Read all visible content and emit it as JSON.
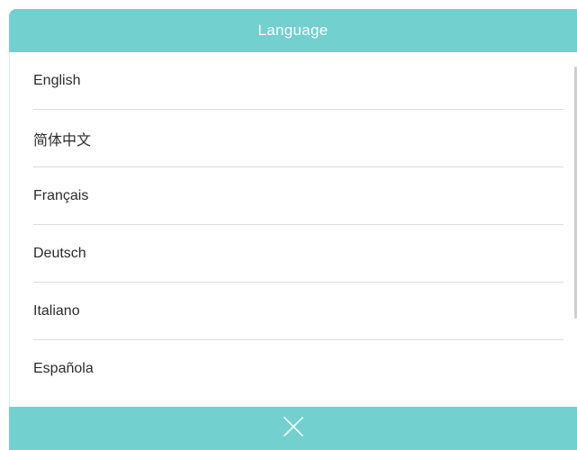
{
  "dialog": {
    "title": "Language",
    "close_icon": "close-icon"
  },
  "languages": [
    {
      "label": "English"
    },
    {
      "label": "简体中文"
    },
    {
      "label": "Français"
    },
    {
      "label": "Deutsch"
    },
    {
      "label": "Italiano"
    },
    {
      "label": "Española"
    }
  ],
  "colors": {
    "accent": "#72d0cf",
    "divider": "#dcdcdc",
    "text": "#2b2b2b"
  }
}
